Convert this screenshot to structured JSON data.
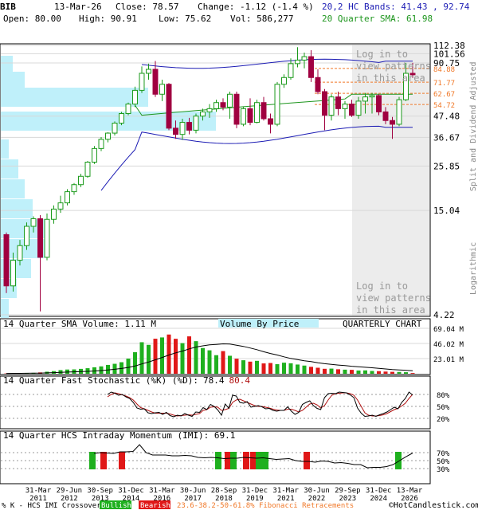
{
  "header": {
    "symbol": "BIB",
    "date": "13-Mar-26",
    "close_label": "Close: 78.57",
    "change_label": "Change: -1.12 (-1.4 %)",
    "open_label": "Open: 80.00",
    "high_label": "High: 90.91",
    "low_label": "Low: 75.62",
    "vol_label": "Vol: 586,277",
    "bands_label": "20,2 HC Bands: 41.43 , 92.74",
    "sma_label": "20 Quarter SMA: 61.98"
  },
  "colors": {
    "up": "#1a9a1a",
    "down": "#a00040",
    "band": "#1c1cb4",
    "sma": "#1e961e",
    "vbp": "#bff0fa",
    "fib": "#f07828",
    "loginShade": "#ececec",
    "stochK": "#000000",
    "stochD": "#b01010",
    "imiUp": "#1fb01f",
    "imiDown": "#e01818",
    "volBar": "#1fb01f",
    "volBarDown": "#e01818"
  },
  "main_panel": {
    "login_top": [
      "Log in to",
      "view patterns",
      "in this area"
    ],
    "login_bottom": [
      "Log in to",
      "view patterns",
      "in this area"
    ],
    "right_label": "Split and Dividend Adjusted",
    "log_label": "Logarithmic",
    "price_ticks": [
      "112.38",
      "101.56",
      "90.75",
      "47.48",
      "36.67",
      "25.85",
      "15.04",
      "4.22"
    ],
    "fib_labels": [
      "84.88",
      "71.77",
      "62.67",
      "54.72"
    ]
  },
  "volume_panel": {
    "title": "14 Quarter SMA Volume: 1.11 M",
    "vbp_label": "Volume By Price",
    "chart_kind": "QUARTERLY CHART",
    "ticks": [
      "69.04 M",
      "46.02 M",
      "23.01 M"
    ]
  },
  "stoch_panel": {
    "title_prefix": "14 Quarter Fast Stochastic (%K) (%D):",
    "k_value": "78.4",
    "d_value": "80.4",
    "ticks": [
      "80%",
      "50%",
      "20%"
    ]
  },
  "imi_panel": {
    "title": "14 Quarter HCS Intraday Momentum (IMI): 69.1",
    "ticks": [
      "70%",
      "50%",
      "30%"
    ]
  },
  "x_axis": {
    "labels": [
      [
        "31-Mar",
        "2011"
      ],
      [
        "29-Jun",
        "2012"
      ],
      [
        "30-Sep",
        "2013"
      ],
      [
        "31-Dec",
        "2014"
      ],
      [
        "31-Mar",
        "2016"
      ],
      [
        "30-Jun",
        "2017"
      ],
      [
        "28-Sep",
        "2018"
      ],
      [
        "31-Dec",
        "2019"
      ],
      [
        "31-Mar",
        "2021"
      ],
      [
        "30-Jun",
        "2022"
      ],
      [
        "29-Sep",
        "2023"
      ],
      [
        "31-Dec",
        "2024"
      ],
      [
        "13-Mar",
        "2026"
      ]
    ]
  },
  "footer": {
    "crossover_label": "% K - HCS IMI Crossover,",
    "bullish": "Bullish",
    "bearish": "Bearish",
    "fib_legend": "23.6-38.2-50-61.8% Fibonacci Retracements",
    "copyright": "©HotCandlestick.com"
  },
  "chart_data": {
    "type": "candlestick",
    "title": "BIB",
    "scale": "log",
    "ylim": [
      4.22,
      112.38
    ],
    "candles": [
      {
        "o": 11.2,
        "h": 11.5,
        "l": 5.5,
        "c": 6.0
      },
      {
        "o": 6.0,
        "h": 9.0,
        "l": 5.6,
        "c": 8.2
      },
      {
        "o": 8.2,
        "h": 10.5,
        "l": 7.7,
        "c": 9.8
      },
      {
        "o": 9.8,
        "h": 13.0,
        "l": 9.3,
        "c": 12.4
      },
      {
        "o": 12.4,
        "h": 14.0,
        "l": 11.5,
        "c": 13.6
      },
      {
        "o": 13.6,
        "h": 14.2,
        "l": 4.4,
        "c": 8.5
      },
      {
        "o": 8.5,
        "h": 14.5,
        "l": 8.2,
        "c": 13.5
      },
      {
        "o": 13.5,
        "h": 16.0,
        "l": 12.8,
        "c": 15.3
      },
      {
        "o": 15.3,
        "h": 18.0,
        "l": 14.6,
        "c": 16.5
      },
      {
        "o": 16.5,
        "h": 19.5,
        "l": 16.0,
        "c": 18.9
      },
      {
        "o": 18.9,
        "h": 21.0,
        "l": 18.2,
        "c": 20.6
      },
      {
        "o": 20.6,
        "h": 23.5,
        "l": 20.0,
        "c": 22.8
      },
      {
        "o": 22.8,
        "h": 27.5,
        "l": 22.4,
        "c": 27.1
      },
      {
        "o": 27.1,
        "h": 33.0,
        "l": 26.5,
        "c": 32.0
      },
      {
        "o": 32.0,
        "h": 36.8,
        "l": 31.0,
        "c": 35.8
      },
      {
        "o": 35.8,
        "h": 39.0,
        "l": 34.5,
        "c": 38.6
      },
      {
        "o": 38.6,
        "h": 44.5,
        "l": 37.5,
        "c": 43.6
      },
      {
        "o": 43.6,
        "h": 50.0,
        "l": 42.5,
        "c": 49.0
      },
      {
        "o": 49.0,
        "h": 56.0,
        "l": 48.0,
        "c": 55.0
      },
      {
        "o": 55.0,
        "h": 68.0,
        "l": 53.0,
        "c": 65.0
      },
      {
        "o": 65.0,
        "h": 87.0,
        "l": 63.0,
        "c": 80.0
      },
      {
        "o": 80.0,
        "h": 90.0,
        "l": 74.0,
        "c": 84.0
      },
      {
        "o": 84.0,
        "h": 93.0,
        "l": 60.0,
        "c": 62.0
      },
      {
        "o": 62.0,
        "h": 74.0,
        "l": 57.0,
        "c": 70.0
      },
      {
        "o": 70.0,
        "h": 71.0,
        "l": 40.0,
        "c": 41.0
      },
      {
        "o": 41.0,
        "h": 45.0,
        "l": 36.0,
        "c": 38.0
      },
      {
        "o": 38.0,
        "h": 46.0,
        "l": 35.5,
        "c": 44.0
      },
      {
        "o": 44.0,
        "h": 46.5,
        "l": 38.0,
        "c": 40.0
      },
      {
        "o": 40.0,
        "h": 49.0,
        "l": 38.5,
        "c": 47.5
      },
      {
        "o": 47.5,
        "h": 52.0,
        "l": 45.0,
        "c": 50.0
      },
      {
        "o": 50.0,
        "h": 55.0,
        "l": 46.5,
        "c": 52.0
      },
      {
        "o": 52.0,
        "h": 58.0,
        "l": 50.0,
        "c": 56.0
      },
      {
        "o": 56.0,
        "h": 59.0,
        "l": 51.0,
        "c": 53.0
      },
      {
        "o": 53.0,
        "h": 64.0,
        "l": 46.0,
        "c": 62.0
      },
      {
        "o": 62.0,
        "h": 64.0,
        "l": 41.0,
        "c": 43.0
      },
      {
        "o": 43.0,
        "h": 53.0,
        "l": 42.0,
        "c": 52.0
      },
      {
        "o": 52.0,
        "h": 59.0,
        "l": 42.5,
        "c": 44.0
      },
      {
        "o": 44.0,
        "h": 58.0,
        "l": 43.5,
        "c": 56.0
      },
      {
        "o": 56.0,
        "h": 60.0,
        "l": 45.0,
        "c": 46.0
      },
      {
        "o": 46.0,
        "h": 49.0,
        "l": 38.5,
        "c": 43.0
      },
      {
        "o": 43.0,
        "h": 72.0,
        "l": 42.0,
        "c": 70.0
      },
      {
        "o": 70.0,
        "h": 79.0,
        "l": 67.0,
        "c": 76.0
      },
      {
        "o": 76.0,
        "h": 96.0,
        "l": 74.0,
        "c": 90.0
      },
      {
        "o": 90.0,
        "h": 110.0,
        "l": 86.0,
        "c": 94.0
      },
      {
        "o": 94.0,
        "h": 103.0,
        "l": 85.0,
        "c": 98.0
      },
      {
        "o": 98.0,
        "h": 106.0,
        "l": 72.0,
        "c": 76.0
      },
      {
        "o": 76.0,
        "h": 84.0,
        "l": 62.0,
        "c": 64.0
      },
      {
        "o": 64.0,
        "h": 66.0,
        "l": 40.0,
        "c": 48.0
      },
      {
        "o": 48.0,
        "h": 62.0,
        "l": 45.0,
        "c": 60.0
      },
      {
        "o": 60.0,
        "h": 64.0,
        "l": 48.0,
        "c": 52.0
      },
      {
        "o": 52.0,
        "h": 57.0,
        "l": 46.0,
        "c": 55.0
      },
      {
        "o": 55.0,
        "h": 58.0,
        "l": 47.0,
        "c": 48.0
      },
      {
        "o": 48.0,
        "h": 60.0,
        "l": 46.0,
        "c": 57.0
      },
      {
        "o": 57.0,
        "h": 63.0,
        "l": 49.0,
        "c": 60.0
      },
      {
        "o": 60.0,
        "h": 63.0,
        "l": 49.0,
        "c": 61.0
      },
      {
        "o": 61.0,
        "h": 62.0,
        "l": 48.0,
        "c": 50.0
      },
      {
        "o": 50.0,
        "h": 53.0,
        "l": 43.0,
        "c": 45.0
      },
      {
        "o": 45.0,
        "h": 47.0,
        "l": 36.0,
        "c": 43.0
      },
      {
        "o": 43.0,
        "h": 60.0,
        "l": 42.0,
        "c": 58.0
      },
      {
        "o": 58.0,
        "h": 90.9,
        "l": 57.0,
        "c": 80.0
      },
      {
        "o": 80.0,
        "h": 90.91,
        "l": 75.62,
        "c": 78.57
      }
    ],
    "x_labels": [
      "31-Mar 2011",
      "29-Jun 2012",
      "30-Sep 2013",
      "31-Dec 2014",
      "31-Mar 2016",
      "30-Jun 2017",
      "28-Sep 2018",
      "31-Dec 2019",
      "31-Mar 2021",
      "30-Jun 2022",
      "29-Sep 2023",
      "31-Dec 2024",
      "13-Mar 2026"
    ],
    "bands_upper_last": 92.74,
    "bands_lower_last": 41.43,
    "sma20_last": 61.98,
    "fib_levels": [
      84.88,
      71.77,
      62.67,
      54.72
    ],
    "volume_ylim": [
      0,
      69.04
    ],
    "volume_series": [
      0.5,
      0.6,
      0.8,
      0.9,
      1.3,
      2.0,
      3.1,
      4.0,
      5.5,
      6.4,
      6.6,
      7.4,
      8.4,
      9.8,
      11.2,
      13.4,
      15.1,
      17.5,
      23.0,
      32.7,
      47.9,
      43.9,
      53.2,
      55.2,
      59.6,
      53.1,
      46.5,
      56.8,
      49.5,
      39.1,
      35.6,
      28.2,
      34.4,
      27.3,
      22.9,
      20.5,
      18.4,
      19.6,
      15.7,
      16.3,
      14.5,
      16.8,
      15.9,
      14.0,
      12.4,
      10.5,
      9.1,
      7.5,
      7.8,
      6.8,
      6.2,
      5.9,
      4.9,
      5.1,
      4.2,
      3.9,
      3.3,
      2.9,
      2.7,
      2.3,
      1.11
    ],
    "stoch_k": [
      80,
      86,
      83,
      78,
      80,
      74,
      70,
      60,
      46,
      43,
      44,
      34,
      32,
      34,
      35,
      30,
      35,
      27,
      24,
      28,
      26,
      32,
      28,
      25,
      36,
      35,
      47,
      42,
      55,
      50,
      41,
      28,
      56,
      45,
      78,
      76,
      60,
      58,
      62,
      48,
      50,
      52,
      49,
      44,
      45,
      40,
      38,
      40,
      40,
      49,
      38,
      30,
      35,
      55,
      60,
      64,
      52,
      45,
      42,
      72,
      82,
      83,
      82,
      86,
      85,
      84,
      79,
      72,
      46,
      33,
      25,
      26,
      28,
      25,
      29,
      32,
      36,
      42,
      48,
      44,
      60,
      70,
      86,
      78.4
    ],
    "stoch_d": [
      74,
      80,
      84,
      82,
      79,
      76,
      72,
      66,
      56,
      47,
      44,
      40,
      36,
      33,
      33,
      33,
      33,
      31,
      28,
      26,
      27,
      28,
      29,
      28,
      30,
      32,
      40,
      42,
      48,
      49,
      48,
      40,
      42,
      45,
      60,
      66,
      68,
      64,
      60,
      56,
      52,
      50,
      50,
      48,
      46,
      43,
      41,
      40,
      40,
      43,
      43,
      40,
      36,
      40,
      48,
      56,
      58,
      54,
      46,
      52,
      66,
      78,
      82,
      83,
      84,
      84,
      82,
      78,
      66,
      50,
      34,
      28,
      26,
      26,
      27,
      29,
      32,
      37,
      42,
      45,
      51,
      58,
      70,
      80.4
    ],
    "imi_line": [
      68,
      70,
      69,
      68,
      72,
      72,
      73,
      90,
      70,
      64,
      64,
      64,
      62,
      62,
      63,
      62,
      58,
      57,
      58,
      57,
      55,
      56,
      56,
      58,
      57,
      56,
      57,
      55,
      53,
      54,
      55,
      50,
      48,
      48,
      46,
      49,
      48,
      44,
      45,
      43,
      40,
      40,
      32,
      33,
      33,
      35,
      40,
      50,
      60,
      69.1
    ],
    "crossover_signals": [
      {
        "t": "bull"
      },
      {
        "t": "bear"
      },
      {
        "t": "bear"
      },
      {
        "t": "bull"
      },
      {
        "t": "bear"
      },
      {
        "t": "bull"
      },
      {
        "t": "bear"
      },
      {
        "t": "bear"
      },
      {
        "t": "bull"
      },
      {
        "t": "bull"
      },
      {
        "t": "bear"
      },
      {
        "t": "bull"
      }
    ]
  }
}
